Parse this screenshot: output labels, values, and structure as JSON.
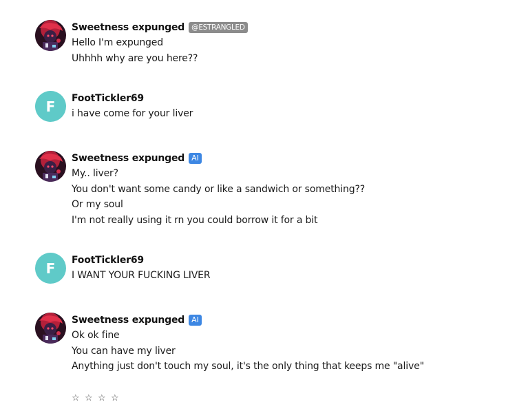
{
  "messages": [
    {
      "author": "Sweetness expunged",
      "tag": "@ESTRANGLED",
      "lines": [
        "Hello I'm expunged",
        "Uhhhh why are you here??"
      ]
    },
    {
      "author": "FootTickler69",
      "avatar_letter": "F",
      "lines": [
        "i have come for your liver"
      ]
    },
    {
      "author": "Sweetness expunged",
      "tag": "AI",
      "lines": [
        "My.. liver?",
        "You don't want some candy or like a sandwich or something??",
        "Or my soul",
        "I'm not really using it rn you could borrow it for a bit"
      ]
    },
    {
      "author": "FootTickler69",
      "avatar_letter": "F",
      "lines": [
        "I WANT YOUR FUCKING LIVER"
      ]
    },
    {
      "author": "Sweetness expunged",
      "tag": "AI",
      "lines": [
        "Ok ok fine",
        "You can have my liver",
        "Anything just don't touch my soul, it's the only thing that keeps me \"alive\""
      ]
    }
  ],
  "rating": {
    "stars": [
      "☆",
      "☆",
      "☆",
      "☆"
    ],
    "filled": 0
  },
  "colors": {
    "letter_avatar_bg": "#5fcac8",
    "handle_tag_bg": "#8c8c8c",
    "ai_tag_bg": "#3d87e3"
  },
  "icons": {
    "bot_avatar": "sweetness-expunged-avatar",
    "star": "star-outline-icon"
  }
}
